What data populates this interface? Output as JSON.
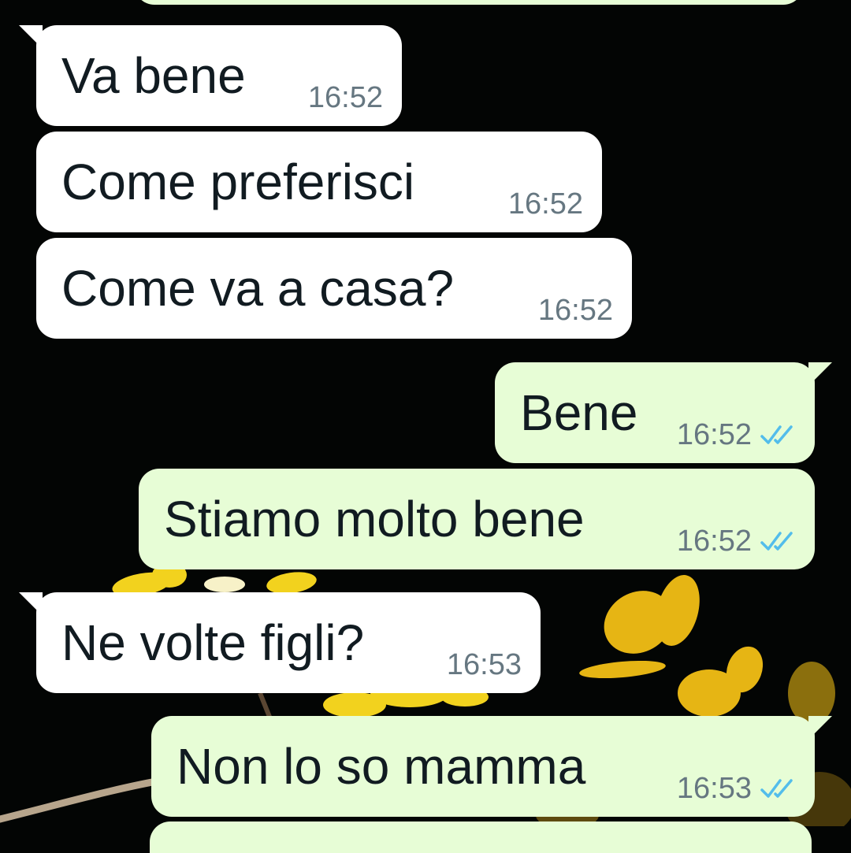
{
  "colors": {
    "background": "#030504",
    "incoming_bubble": "#ffffff",
    "outgoing_bubble": "#e7fdd6",
    "message_text": "#111b21",
    "timestamp_text": "#667781",
    "read_ticks": "#53bdeb"
  },
  "messages": [
    {
      "direction": "incoming",
      "text": "Va bene",
      "time": "16:52"
    },
    {
      "direction": "incoming",
      "text": "Come preferisci",
      "time": "16:52"
    },
    {
      "direction": "incoming",
      "text": "Come va a casa?",
      "time": "16:52"
    },
    {
      "direction": "outgoing",
      "text": "Bene",
      "time": "16:52",
      "status_icon": "double-check-read-icon"
    },
    {
      "direction": "outgoing",
      "text": "Stiamo molto bene",
      "time": "16:52",
      "status_icon": "double-check-read-icon"
    },
    {
      "direction": "incoming",
      "text": "Ne volte figli?",
      "time": "16:53"
    },
    {
      "direction": "outgoing",
      "text": "Non lo so mamma",
      "time": "16:53",
      "status_icon": "double-check-read-icon"
    }
  ]
}
